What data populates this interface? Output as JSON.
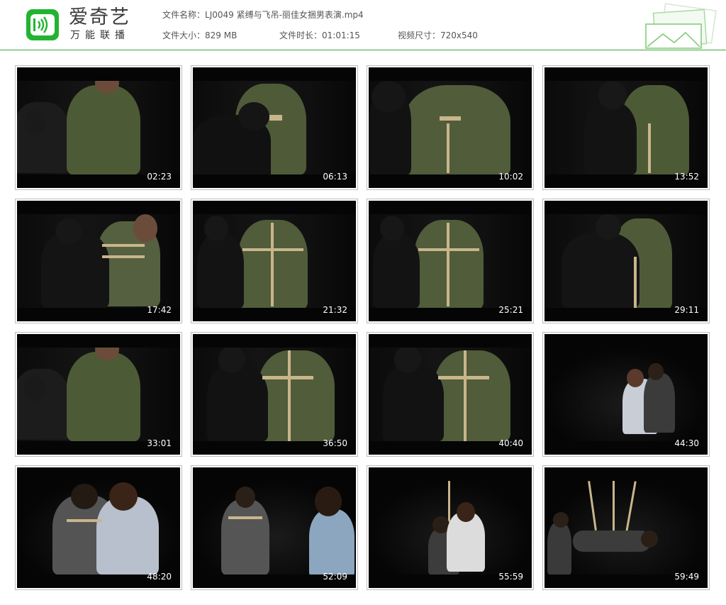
{
  "header": {
    "logo_title": "爱奇艺",
    "logo_subtitle": "万能联播",
    "file_name_label": "文件名称：",
    "file_name": "LJ0049 紧缚与飞吊-丽佳女捆男表演.mp4",
    "file_size_label": "文件大小：",
    "file_size": "829 MB",
    "duration_label": "文件时长：",
    "duration": "01:01:15",
    "resolution_label": "视频尺寸：",
    "resolution": "720x540",
    "accent_color": "#22b431"
  },
  "thumbnails": [
    {
      "timestamp": "02:23",
      "scene": "woman-left-man-back-green"
    },
    {
      "timestamp": "06:13",
      "scene": "woman-tying-wrists-green"
    },
    {
      "timestamp": "10:02",
      "scene": "closeup-hands-rope-green"
    },
    {
      "timestamp": "13:52",
      "scene": "woman-behind-man-green"
    },
    {
      "timestamp": "17:42",
      "scene": "woman-front-chest-harness"
    },
    {
      "timestamp": "21:32",
      "scene": "back-view-rope-green"
    },
    {
      "timestamp": "25:21",
      "scene": "back-view-rope-green"
    },
    {
      "timestamp": "29:11",
      "scene": "woman-leaning-man-green"
    },
    {
      "timestamp": "33:01",
      "scene": "woman-left-man-back-green"
    },
    {
      "timestamp": "36:50",
      "scene": "arms-tied-behind-green"
    },
    {
      "timestamp": "40:40",
      "scene": "arms-tied-behind-green"
    },
    {
      "timestamp": "44:30",
      "scene": "hoodie-couple-small"
    },
    {
      "timestamp": "48:20",
      "scene": "hoodie-tying-grey-shirt"
    },
    {
      "timestamp": "52:09",
      "scene": "grey-shirt-back-hoodie"
    },
    {
      "timestamp": "55:59",
      "scene": "suspension-start"
    },
    {
      "timestamp": "59:49",
      "scene": "full-suspension"
    }
  ]
}
